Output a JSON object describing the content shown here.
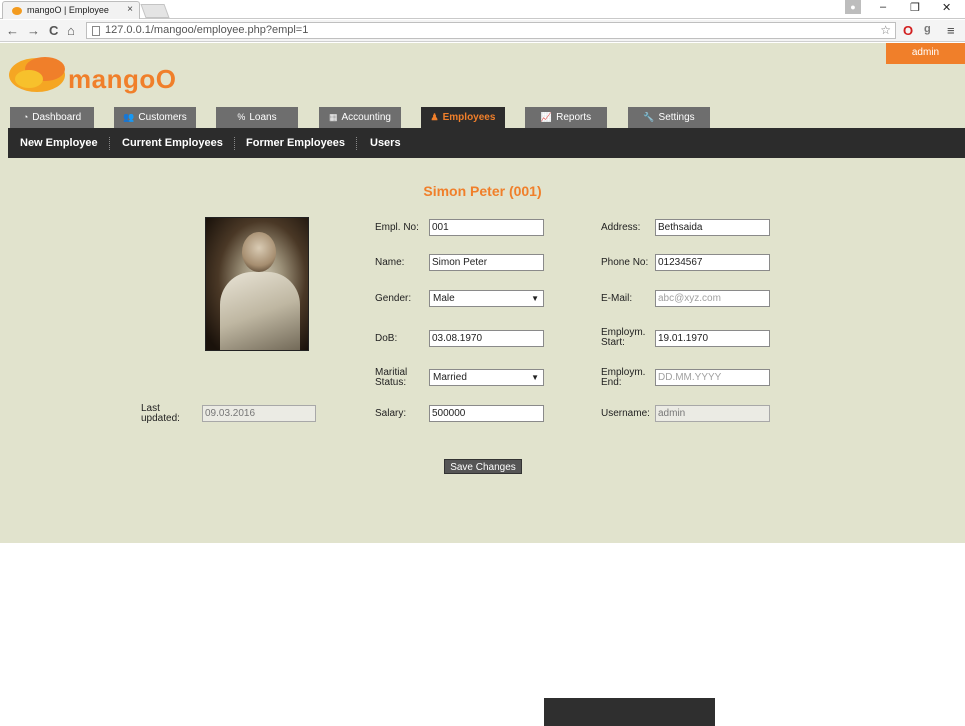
{
  "browser": {
    "tab_title": "mangoO | Employee",
    "tab_close": "×",
    "url": "127.0.0.1/mangoo/employee.php?empl=1",
    "minimize": "–",
    "restore": "❐",
    "close": "✕",
    "back": "←",
    "forward": "→",
    "reload": "C",
    "home": "⌂",
    "star": "☆",
    "menu": "≡"
  },
  "header": {
    "admin_label": "admin",
    "logo_text": "mangoO",
    "brand_color": "#f07f2a"
  },
  "main_tabs": [
    {
      "label": "Dashboard",
      "icon": "dashboard-icon",
      "glyph": "◔"
    },
    {
      "label": "Customers",
      "icon": "users-icon",
      "glyph": "👥"
    },
    {
      "label": "Loans",
      "icon": "percent-icon",
      "glyph": "%"
    },
    {
      "label": "Accounting",
      "icon": "calculator-icon",
      "glyph": "▦"
    },
    {
      "label": "Employees",
      "icon": "person-icon",
      "glyph": "♟"
    },
    {
      "label": "Reports",
      "icon": "chart-icon",
      "glyph": "📈"
    },
    {
      "label": "Settings",
      "icon": "wrench-icon",
      "glyph": "🔧"
    }
  ],
  "sub_nav": [
    "New Employee",
    "Current Employees",
    "Former Employees",
    "Users"
  ],
  "employee": {
    "heading": "Simon Peter (001)",
    "last_updated_label": "Last updated:",
    "last_updated": "09.03.2016",
    "fields_left": {
      "empl_no_label": "Empl. No:",
      "empl_no": "001",
      "name_label": "Name:",
      "name": "Simon Peter",
      "gender_label": "Gender:",
      "gender": "Male",
      "dob_label": "DoB:",
      "dob": "03.08.1970",
      "marital_label": "Maritial Status:",
      "marital": "Married",
      "salary_label": "Salary:",
      "salary": "500000"
    },
    "fields_right": {
      "address_label": "Address:",
      "address": "Bethsaida",
      "phone_label": "Phone No:",
      "phone": "01234567",
      "email_label": "E-Mail:",
      "email_placeholder": "abc@xyz.com",
      "start_label": "Employm. Start:",
      "start": "19.01.1970",
      "end_label": "Employm. End:",
      "end_placeholder": "DD.MM.YYYY",
      "username_label": "Username:",
      "username": "admin"
    },
    "save_label": "Save Changes"
  }
}
